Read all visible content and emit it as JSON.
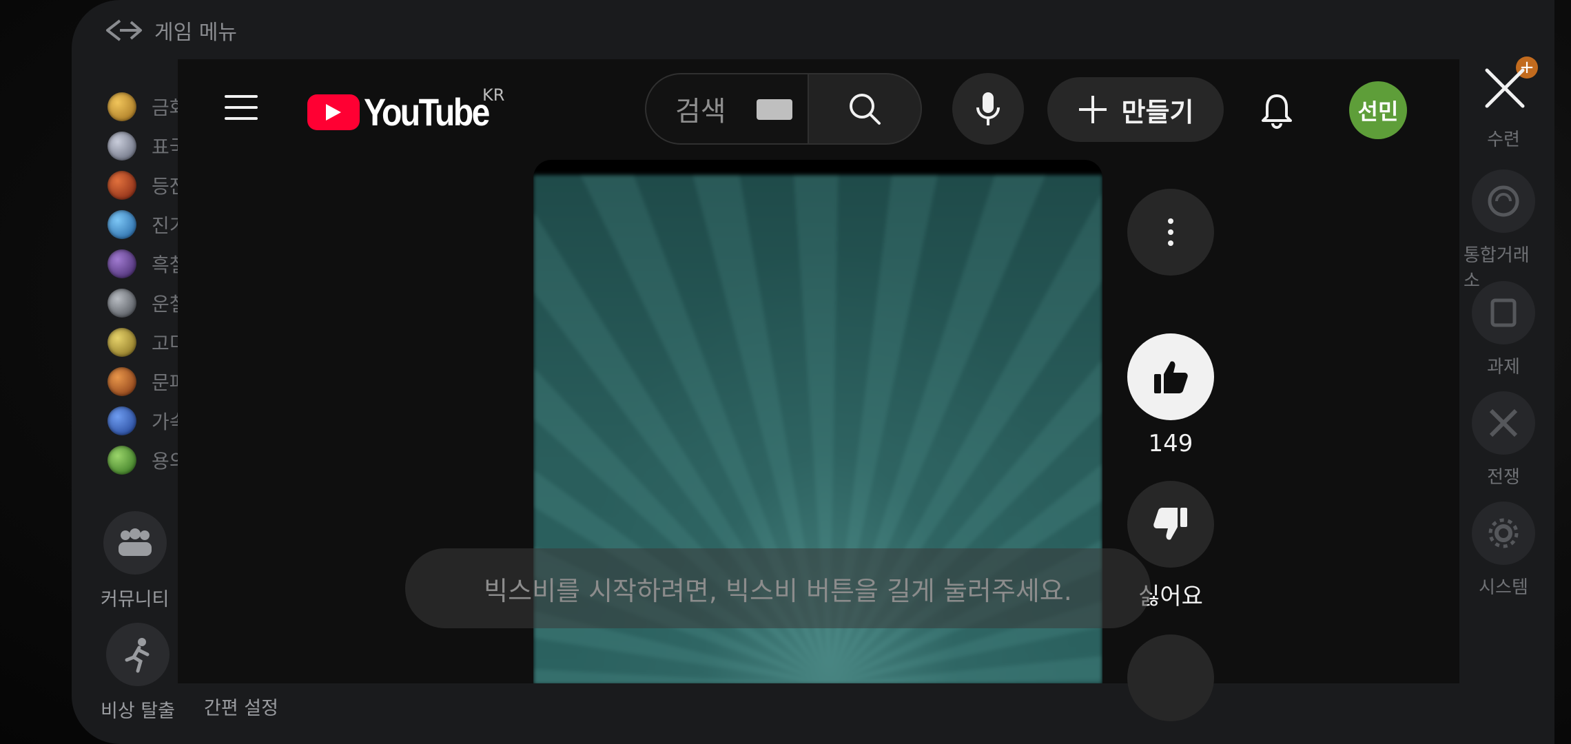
{
  "game_menu": {
    "title": "게임 메뉴",
    "currencies": [
      {
        "label": "금화",
        "color": "#c9962e"
      },
      {
        "label": "표국",
        "color": "#8a8fa0"
      },
      {
        "label": "등잔",
        "color": "#b0442c"
      },
      {
        "label": "진기",
        "color": "#3a8fcf"
      },
      {
        "label": "흑철",
        "color": "#6a4a9a"
      },
      {
        "label": "운철",
        "color": "#7a7f86"
      },
      {
        "label": "고미",
        "color": "#c8b03a"
      },
      {
        "label": "문파",
        "color": "#c06a2a"
      },
      {
        "label": "가속",
        "color": "#3a6fd0"
      },
      {
        "label": "용의",
        "color": "#5aa03a"
      }
    ],
    "community_label": "커뮤니티",
    "emergency_escape_label": "비상 탈출",
    "quick_settings_label": "간편 설정",
    "right_menu": [
      "수련",
      "통합거래소",
      "과제",
      "전쟁",
      "시스템"
    ],
    "plus_badge": "+"
  },
  "youtube": {
    "logo_text": "YouTube",
    "region": "KR",
    "search_placeholder": "검색",
    "create_label": "만들기",
    "avatar_text": "선민",
    "like_count": "149",
    "dislike_label": "싫어요"
  },
  "bixby_toast": "빅스비를 시작하려면, 빅스비 버튼을 길게 눌러주세요.",
  "icons": [
    "menu-icon",
    "youtube-play-icon",
    "keyboard-icon",
    "search-icon",
    "mic-icon",
    "plus-icon",
    "bell-icon",
    "more-vert-icon",
    "thumb-up-icon",
    "thumb-down-icon",
    "close-icon"
  ],
  "colors": {
    "yt_red": "#ff0033",
    "avatar_bg": "#5e9e39",
    "bg": "#0f0f0f"
  }
}
